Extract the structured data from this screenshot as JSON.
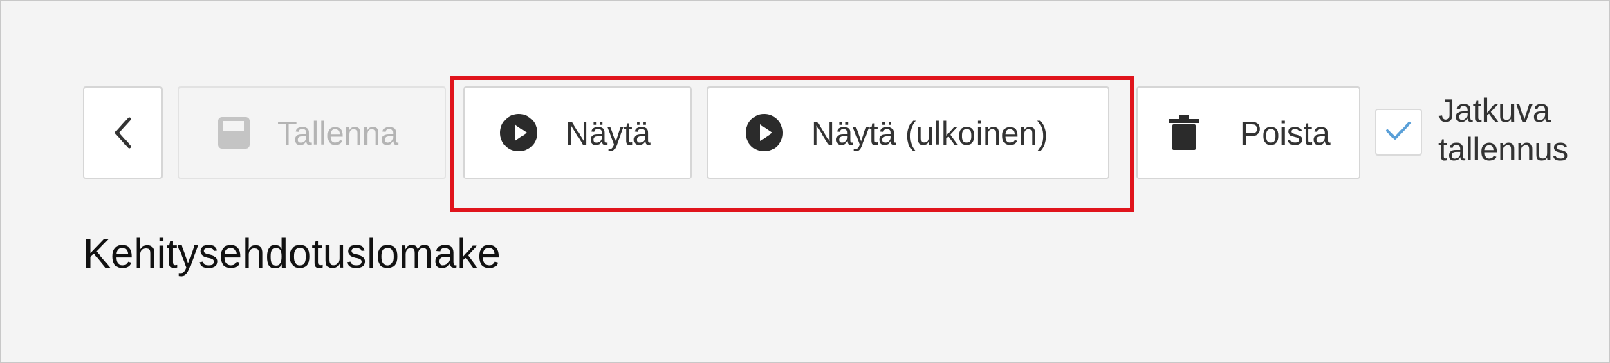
{
  "toolbar": {
    "back_button": {
      "icon": "chevron-left-icon"
    },
    "save_button": {
      "label": "Tallenna",
      "icon": "save-icon",
      "disabled": true
    },
    "preview_button": {
      "label": "Näytä",
      "icon": "play-circle-icon"
    },
    "preview_external_button": {
      "label": "Näytä (ulkoinen)",
      "icon": "play-circle-icon"
    },
    "delete_button": {
      "label": "Poista",
      "icon": "trash-icon"
    },
    "autosave": {
      "checked": true,
      "label_line1": "Jatkuva",
      "label_line2": "tallennus",
      "icon": "check-icon"
    }
  },
  "page": {
    "title": "Kehitysehdotuslomake"
  },
  "colors": {
    "highlight": "#e0141c",
    "check": "#5aa0d8",
    "background": "#f4f4f4"
  }
}
